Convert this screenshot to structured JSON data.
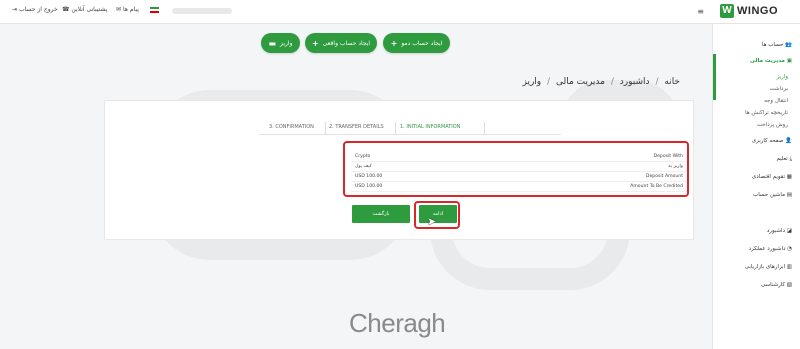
{
  "topbar": {
    "logout": "خروج از حساب",
    "support": "پشتیبانی آنلاین",
    "messages": "پیام ها",
    "menu_icon": "≡",
    "brand": "WINGO",
    "brand_mark": "W"
  },
  "sidebar": {
    "items": [
      {
        "label": "حساب ها"
      },
      {
        "label": "مدیریت مالی"
      },
      {
        "label": "صفحه کاربری"
      },
      {
        "label": "تعلیم"
      },
      {
        "label": "تقویم اقتصادی"
      },
      {
        "label": "ماشین حساب"
      },
      {
        "label": "داشبورد"
      },
      {
        "label": "داشبورد عملکرد"
      },
      {
        "label": "ابزارهای بازاریابی"
      },
      {
        "label": "کارشناسی"
      }
    ],
    "sub_items": [
      {
        "label": "واریز"
      },
      {
        "label": "برداشت"
      },
      {
        "label": "انتقال وجه"
      },
      {
        "label": "تاریخچه تراکنش ها"
      },
      {
        "label": "روش پرداخت"
      }
    ]
  },
  "actions": {
    "demo": "ایجاد حساب دمو",
    "real": "ایجاد حساب واقعی",
    "deposit": "واریز"
  },
  "breadcrumb": {
    "home": "خانه",
    "dashboard": "داشبورد",
    "finance": "مدیریت مالی",
    "current": "واریز",
    "sep": "/"
  },
  "steps": {
    "s1": "1. INITIAL INFORMATION",
    "s2": "2. TRANSFER DETAILS",
    "s3": "3. CONFIRMATION"
  },
  "summary": {
    "rows": [
      {
        "label": "Deposit With",
        "value": "Crypto"
      },
      {
        "label": "واریز به",
        "value": "کیف پول"
      },
      {
        "label": "Deposit Amount",
        "value": "USD 100.00"
      },
      {
        "label": "Amount To Be Credited",
        "value": "USD 100.00"
      }
    ]
  },
  "buttons": {
    "back": "بازگشت",
    "next": "ادامه"
  },
  "watermark": "Cheragh",
  "colors": {
    "accent": "#2e9b3f",
    "highlight": "#d8262a"
  }
}
